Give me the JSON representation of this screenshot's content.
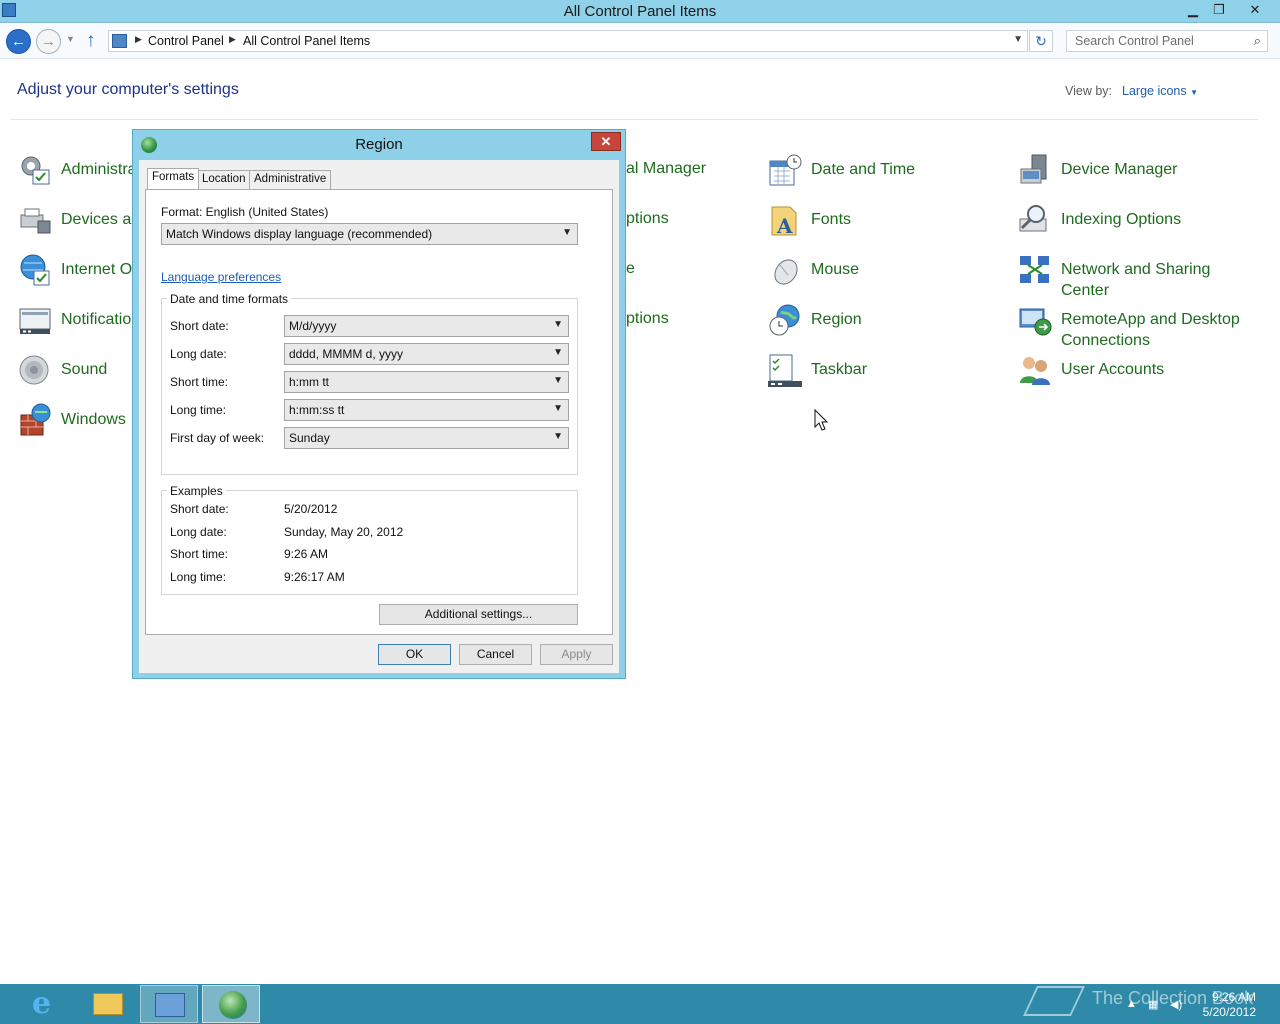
{
  "window": {
    "title": "All Control Panel Items",
    "minimize": "▁",
    "maximize": "❐",
    "close": "✕"
  },
  "nav": {
    "back": "←",
    "forward": "→",
    "up": "↑",
    "breadcrumb": [
      "Control Panel",
      "All Control Panel Items"
    ],
    "search_placeholder": "Search Control Panel",
    "refresh": "↻"
  },
  "main": {
    "heading": "Adjust your computer's settings",
    "view_by_label": "View by:",
    "view_by_value": "Large icons"
  },
  "items_col1": [
    {
      "label": "Administra",
      "icon": "admin-tools-icon"
    },
    {
      "label": "Devices an",
      "icon": "devices-printers-icon"
    },
    {
      "label": "Internet O",
      "icon": "internet-options-icon"
    },
    {
      "label": "Notificatio",
      "icon": "notification-area-icon"
    },
    {
      "label": "Sound",
      "icon": "sound-icon"
    },
    {
      "label": "Windows",
      "icon": "windows-firewall-icon"
    }
  ],
  "items_col3_partial": [
    "al Manager",
    "ptions",
    "e",
    "ptions"
  ],
  "items_col4": [
    {
      "label": "Date and Time",
      "icon": "date-time-icon"
    },
    {
      "label": "Fonts",
      "icon": "fonts-icon"
    },
    {
      "label": "Mouse",
      "icon": "mouse-icon"
    },
    {
      "label": "Region",
      "icon": "region-icon"
    },
    {
      "label": "Taskbar",
      "icon": "taskbar-icon"
    }
  ],
  "items_col5": [
    {
      "label": "Device Manager",
      "icon": "device-manager-icon"
    },
    {
      "label": "Indexing Options",
      "icon": "indexing-options-icon"
    },
    {
      "label": "Network and Sharing",
      "label2": "Center",
      "icon": "network-sharing-icon"
    },
    {
      "label": "RemoteApp and Desktop",
      "label2": "Connections",
      "icon": "remoteapp-icon"
    },
    {
      "label": "User Accounts",
      "icon": "user-accounts-icon"
    }
  ],
  "dialog": {
    "title": "Region",
    "close": "✕",
    "tabs": [
      "Formats",
      "Location",
      "Administrative"
    ],
    "format_label": "Format: English (United States)",
    "format_value": "Match Windows display language (recommended)",
    "language_link": "Language preferences",
    "date_time_group": "Date and time formats",
    "fields": [
      {
        "label": "Short date:",
        "value": "M/d/yyyy"
      },
      {
        "label": "Long date:",
        "value": "dddd, MMMM d, yyyy"
      },
      {
        "label": "Short time:",
        "value": "h:mm tt"
      },
      {
        "label": "Long time:",
        "value": "h:mm:ss tt"
      },
      {
        "label": "First day of week:",
        "value": "Sunday"
      }
    ],
    "examples_group": "Examples",
    "examples": [
      {
        "label": "Short date:",
        "value": "5/20/2012"
      },
      {
        "label": "Long date:",
        "value": "Sunday, May 20, 2012"
      },
      {
        "label": "Short time:",
        "value": "9:26 AM"
      },
      {
        "label": "Long time:",
        "value": "9:26:17 AM"
      }
    ],
    "additional_button": "Additional settings...",
    "ok": "OK",
    "cancel": "Cancel",
    "apply": "Apply"
  },
  "taskbar": {
    "watermark": "The Collection Book",
    "time": "9:26 AM",
    "date": "5/20/2012"
  },
  "colors": {
    "titlebar": "#8fd1e8",
    "link_green": "#1d6b1d",
    "heading_blue": "#1e3287",
    "taskbar": "#2e8aa8"
  }
}
